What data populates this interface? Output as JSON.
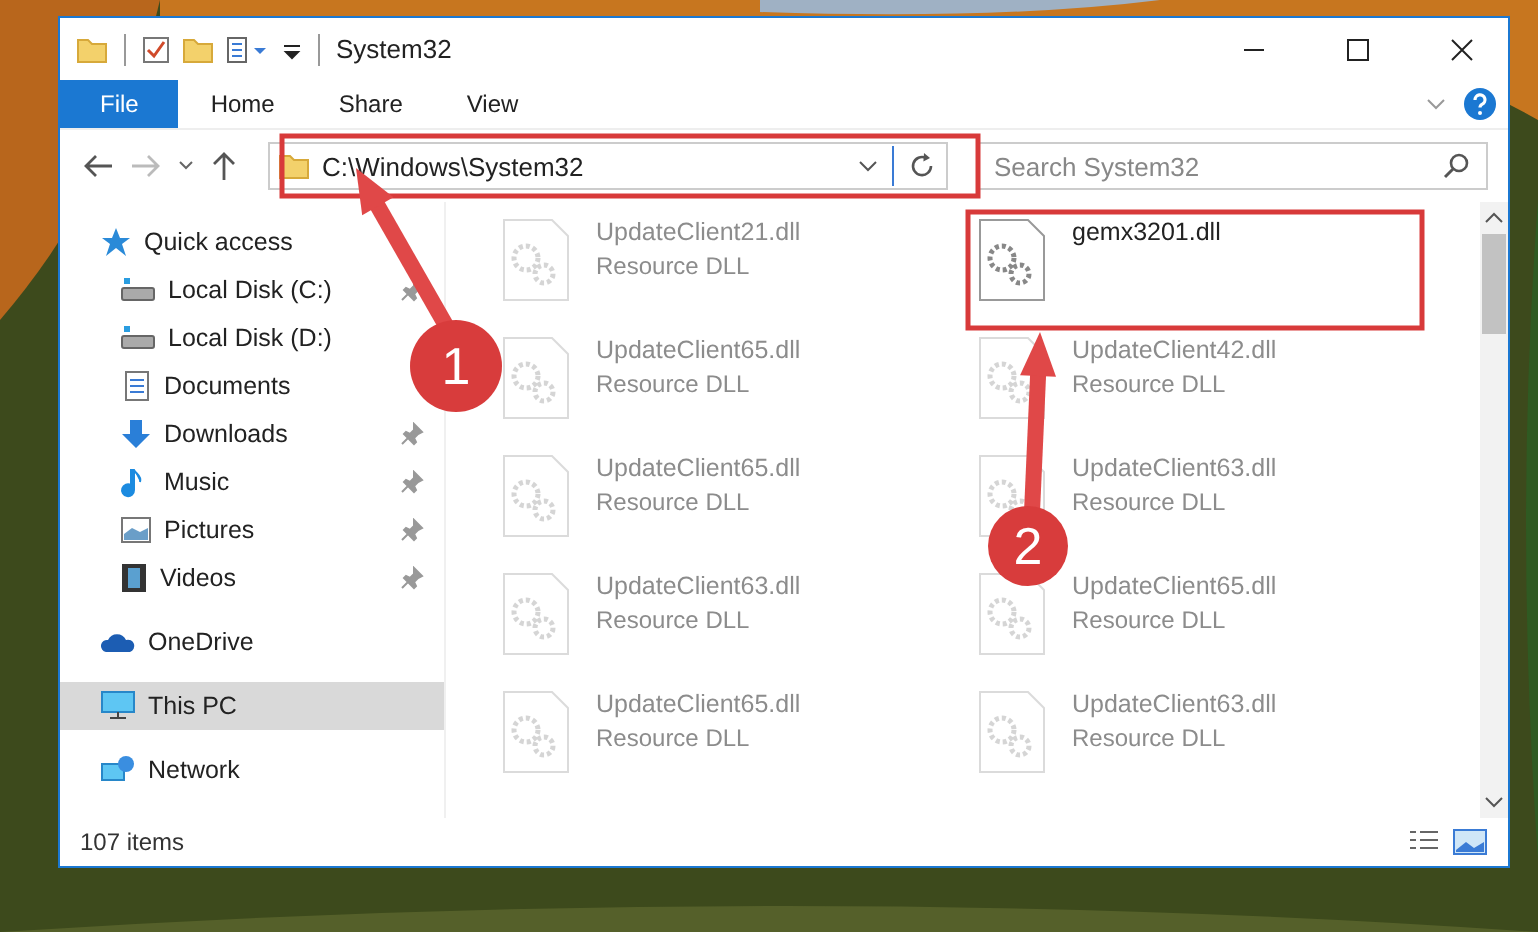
{
  "window": {
    "title": "System32"
  },
  "ribbon_tabs": [
    {
      "label": "File",
      "selected": true
    },
    {
      "label": "Home",
      "selected": false
    },
    {
      "label": "Share",
      "selected": false
    },
    {
      "label": "View",
      "selected": false
    }
  ],
  "address_bar": {
    "path": "C:\\Windows\\System32"
  },
  "search": {
    "placeholder": "Search System32"
  },
  "sidebar": {
    "items": [
      {
        "label": "Quick access",
        "kind": "star",
        "selected": false,
        "children": [
          {
            "label": "Local Disk (C:)",
            "kind": "drive",
            "selected": false,
            "pinned": true
          },
          {
            "label": "Local Disk (D:)",
            "kind": "drive",
            "selected": false,
            "pinned": false
          },
          {
            "label": "Documents",
            "kind": "documents",
            "selected": false,
            "pinned": false
          },
          {
            "label": "Downloads",
            "kind": "downloads",
            "selected": false,
            "pinned": true
          },
          {
            "label": "Music",
            "kind": "music",
            "selected": false,
            "pinned": true
          },
          {
            "label": "Pictures",
            "kind": "pictures",
            "selected": false,
            "pinned": true
          },
          {
            "label": "Videos",
            "kind": "videos",
            "selected": false,
            "pinned": true
          }
        ]
      },
      {
        "label": "OneDrive",
        "kind": "cloud",
        "selected": false
      },
      {
        "label": "This PC",
        "kind": "pc",
        "selected": true
      },
      {
        "label": "Network",
        "kind": "network",
        "selected": false
      }
    ]
  },
  "files": [
    {
      "name": "UpdateClient21.dll",
      "type": "Resource DLL",
      "faded": true
    },
    {
      "name": "gemx3201.dll",
      "faded": false
    },
    {
      "name": "UpdateClient65.dll",
      "type": "Resource DLL",
      "faded": true
    },
    {
      "name": "UpdateClient42.dll",
      "type": "Resource DLL",
      "faded": true
    },
    {
      "name": "UpdateClient65.dll",
      "type": "Resource DLL",
      "faded": true
    },
    {
      "name": "UpdateClient63.dll",
      "type": "Resource DLL",
      "faded": true
    },
    {
      "name": "UpdateClient63.dll",
      "type": "Resource DLL",
      "faded": true
    },
    {
      "name": "UpdateClient65.dll",
      "type": "Resource DLL",
      "faded": true
    },
    {
      "name": "UpdateClient65.dll",
      "type": "Resource DLL",
      "faded": true
    },
    {
      "name": "UpdateClient63.dll",
      "type": "Resource DLL",
      "faded": true
    }
  ],
  "status_bar": {
    "item_count": "107 items"
  },
  "annotations": [
    {
      "label": "1"
    },
    {
      "label": "2"
    }
  ]
}
